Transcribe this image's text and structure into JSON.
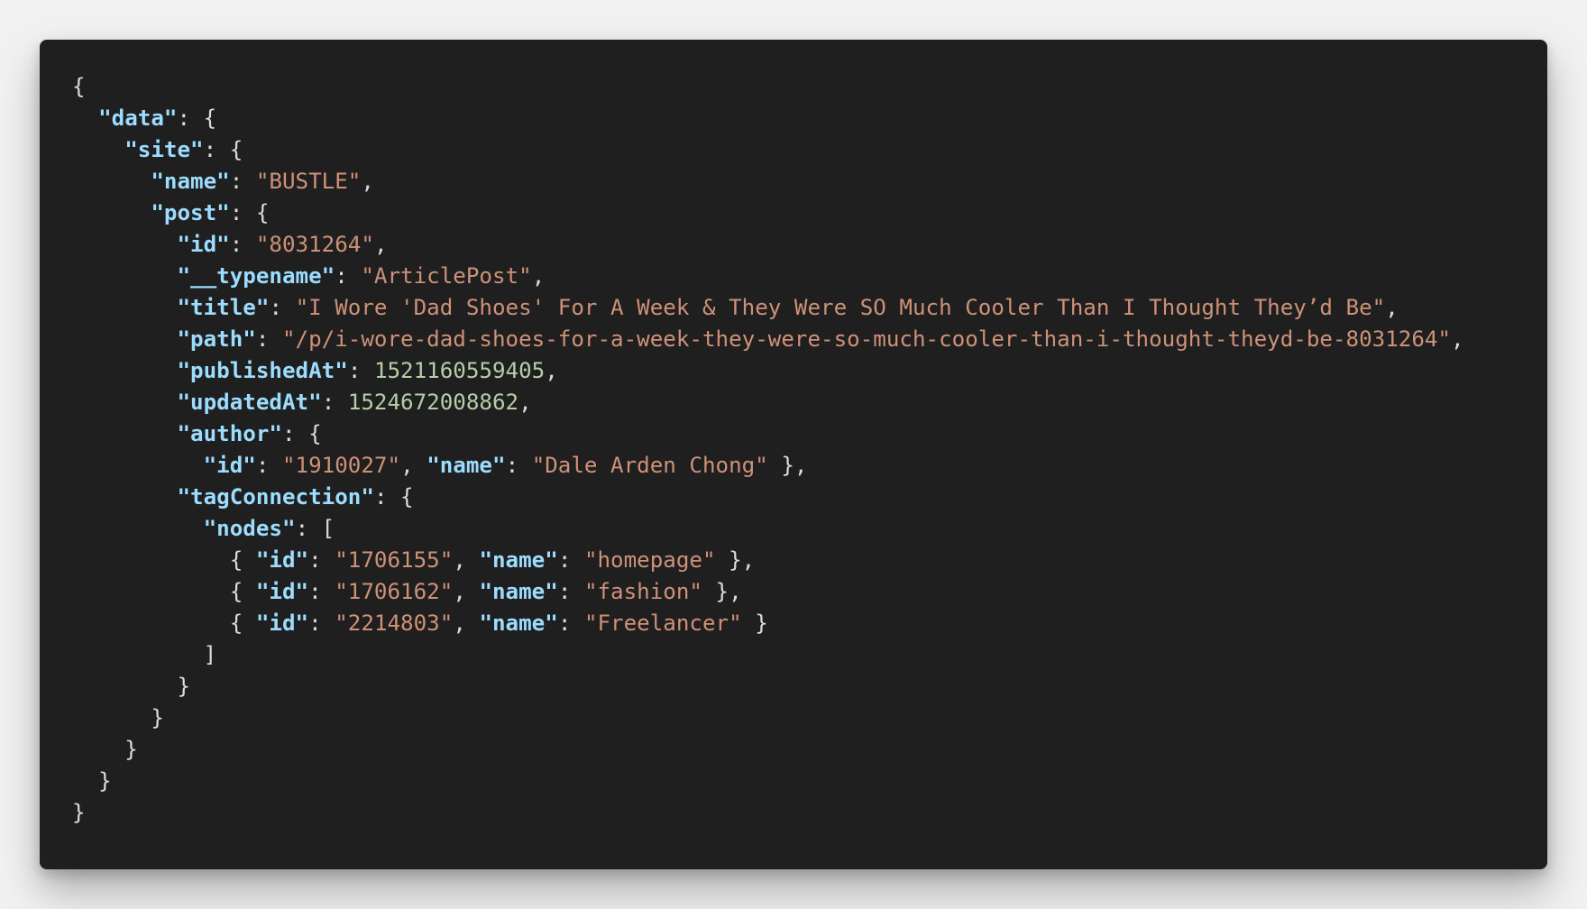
{
  "code_viewer": {
    "lines": [
      [
        {
          "t": "p",
          "v": "{"
        }
      ],
      [
        {
          "t": "p",
          "v": "  "
        },
        {
          "t": "k",
          "v": "\"data\""
        },
        {
          "t": "p",
          "v": ": {"
        }
      ],
      [
        {
          "t": "p",
          "v": "    "
        },
        {
          "t": "k",
          "v": "\"site\""
        },
        {
          "t": "p",
          "v": ": {"
        }
      ],
      [
        {
          "t": "p",
          "v": "      "
        },
        {
          "t": "k",
          "v": "\"name\""
        },
        {
          "t": "p",
          "v": ": "
        },
        {
          "t": "s",
          "v": "\"BUSTLE\""
        },
        {
          "t": "p",
          "v": ","
        }
      ],
      [
        {
          "t": "p",
          "v": "      "
        },
        {
          "t": "k",
          "v": "\"post\""
        },
        {
          "t": "p",
          "v": ": {"
        }
      ],
      [
        {
          "t": "p",
          "v": "        "
        },
        {
          "t": "k",
          "v": "\"id\""
        },
        {
          "t": "p",
          "v": ": "
        },
        {
          "t": "s",
          "v": "\"8031264\""
        },
        {
          "t": "p",
          "v": ","
        }
      ],
      [
        {
          "t": "p",
          "v": "        "
        },
        {
          "t": "k",
          "v": "\"__typename\""
        },
        {
          "t": "p",
          "v": ": "
        },
        {
          "t": "s",
          "v": "\"ArticlePost\""
        },
        {
          "t": "p",
          "v": ","
        }
      ],
      [
        {
          "t": "p",
          "v": "        "
        },
        {
          "t": "k",
          "v": "\"title\""
        },
        {
          "t": "p",
          "v": ": "
        },
        {
          "t": "s",
          "v": "\"I Wore 'Dad Shoes' For A Week & They Were SO Much Cooler Than I Thought They’d Be\""
        },
        {
          "t": "p",
          "v": ","
        }
      ],
      [
        {
          "t": "p",
          "v": "        "
        },
        {
          "t": "k",
          "v": "\"path\""
        },
        {
          "t": "p",
          "v": ": "
        },
        {
          "t": "s",
          "v": "\"/p/i-wore-dad-shoes-for-a-week-they-were-so-much-cooler-than-i-thought-theyd-be-8031264\""
        },
        {
          "t": "p",
          "v": ","
        }
      ],
      [
        {
          "t": "p",
          "v": "        "
        },
        {
          "t": "k",
          "v": "\"publishedAt\""
        },
        {
          "t": "p",
          "v": ": "
        },
        {
          "t": "n",
          "v": "1521160559405"
        },
        {
          "t": "p",
          "v": ","
        }
      ],
      [
        {
          "t": "p",
          "v": "        "
        },
        {
          "t": "k",
          "v": "\"updatedAt\""
        },
        {
          "t": "p",
          "v": ": "
        },
        {
          "t": "n",
          "v": "1524672008862"
        },
        {
          "t": "p",
          "v": ","
        }
      ],
      [
        {
          "t": "p",
          "v": "        "
        },
        {
          "t": "k",
          "v": "\"author\""
        },
        {
          "t": "p",
          "v": ": {"
        }
      ],
      [
        {
          "t": "p",
          "v": "          "
        },
        {
          "t": "k",
          "v": "\"id\""
        },
        {
          "t": "p",
          "v": ": "
        },
        {
          "t": "s",
          "v": "\"1910027\""
        },
        {
          "t": "p",
          "v": ", "
        },
        {
          "t": "k",
          "v": "\"name\""
        },
        {
          "t": "p",
          "v": ": "
        },
        {
          "t": "s",
          "v": "\"Dale Arden Chong\""
        },
        {
          "t": "p",
          "v": " },"
        }
      ],
      [
        {
          "t": "p",
          "v": "        "
        },
        {
          "t": "k",
          "v": "\"tagConnection\""
        },
        {
          "t": "p",
          "v": ": {"
        }
      ],
      [
        {
          "t": "p",
          "v": "          "
        },
        {
          "t": "k",
          "v": "\"nodes\""
        },
        {
          "t": "p",
          "v": ": ["
        }
      ],
      [
        {
          "t": "p",
          "v": "            { "
        },
        {
          "t": "k",
          "v": "\"id\""
        },
        {
          "t": "p",
          "v": ": "
        },
        {
          "t": "s",
          "v": "\"1706155\""
        },
        {
          "t": "p",
          "v": ", "
        },
        {
          "t": "k",
          "v": "\"name\""
        },
        {
          "t": "p",
          "v": ": "
        },
        {
          "t": "s",
          "v": "\"homepage\""
        },
        {
          "t": "p",
          "v": " },"
        }
      ],
      [
        {
          "t": "p",
          "v": "            { "
        },
        {
          "t": "k",
          "v": "\"id\""
        },
        {
          "t": "p",
          "v": ": "
        },
        {
          "t": "s",
          "v": "\"1706162\""
        },
        {
          "t": "p",
          "v": ", "
        },
        {
          "t": "k",
          "v": "\"name\""
        },
        {
          "t": "p",
          "v": ": "
        },
        {
          "t": "s",
          "v": "\"fashion\""
        },
        {
          "t": "p",
          "v": " },"
        }
      ],
      [
        {
          "t": "p",
          "v": "            { "
        },
        {
          "t": "k",
          "v": "\"id\""
        },
        {
          "t": "p",
          "v": ": "
        },
        {
          "t": "s",
          "v": "\"2214803\""
        },
        {
          "t": "p",
          "v": ", "
        },
        {
          "t": "k",
          "v": "\"name\""
        },
        {
          "t": "p",
          "v": ": "
        },
        {
          "t": "s",
          "v": "\"Freelancer\""
        },
        {
          "t": "p",
          "v": " }"
        }
      ],
      [
        {
          "t": "p",
          "v": "          ]"
        }
      ],
      [
        {
          "t": "p",
          "v": "        }"
        }
      ],
      [
        {
          "t": "p",
          "v": "      }"
        }
      ],
      [
        {
          "t": "p",
          "v": "    }"
        }
      ],
      [
        {
          "t": "p",
          "v": "  }"
        }
      ],
      [
        {
          "t": "p",
          "v": "}"
        }
      ]
    ]
  },
  "colors": {
    "page_background": "#f1f1f1",
    "editor_background": "#1f1f1f",
    "key": "#9cdcfe",
    "string": "#ce9178",
    "number": "#b5cea8",
    "punctuation": "#dcdcdc"
  }
}
